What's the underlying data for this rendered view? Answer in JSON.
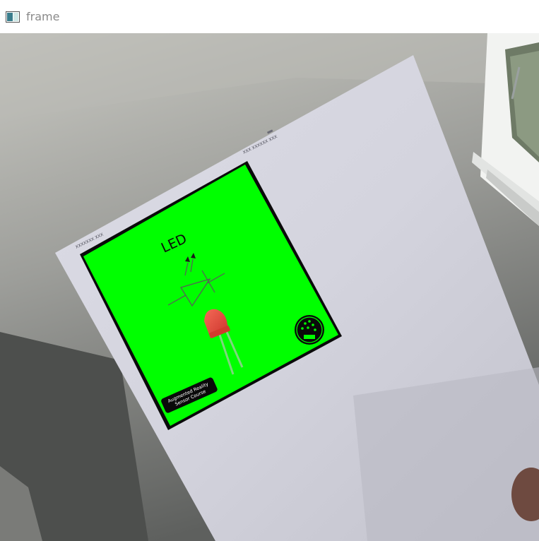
{
  "window": {
    "title": "frame",
    "icon": "opencv-window-icon"
  },
  "marker": {
    "heading": "LED",
    "badge_line1": "Augmented Reality",
    "badge_line2": "Sensor Course",
    "header_left": "XXXXXXX XXX",
    "header_right": "XXX XXXXXX XXX",
    "accent_color": "#00ff00",
    "led_color": "#e84a3a",
    "logo_icon": "circuit-logo-icon"
  }
}
